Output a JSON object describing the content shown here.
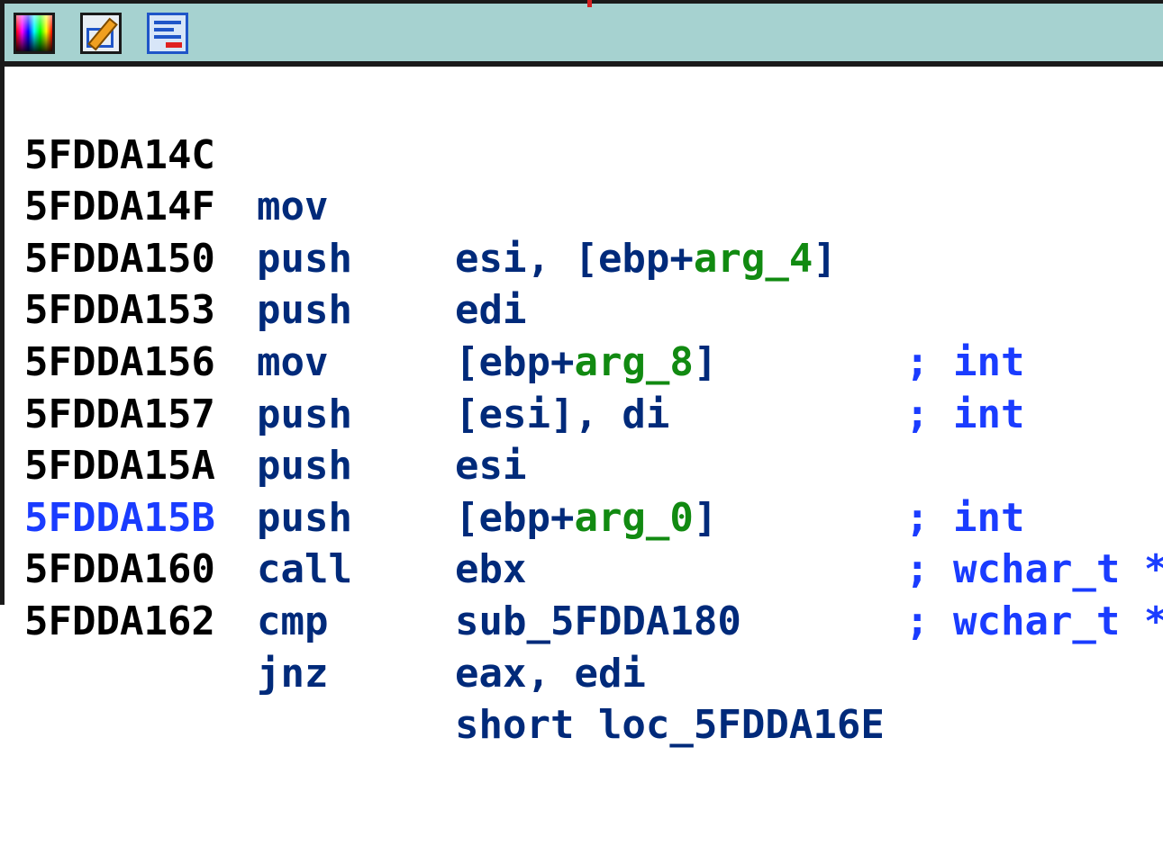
{
  "toolbar": {
    "icons": [
      "color-palette-icon",
      "edit-icon",
      "graph-view-icon"
    ]
  },
  "colors": {
    "titlebar": "#a6d2d0",
    "address": "#000000",
    "address_ref": "#1a3cff",
    "instruction": "#002a7a",
    "argument": "#118a11",
    "comment": "#1a3cff"
  },
  "disassembly": [
    {
      "address": "5FDDA14C",
      "mnemonic": "mov",
      "op_pre": "esi, [ebp+",
      "op_arg": "arg_4",
      "op_post": "]",
      "comment": ""
    },
    {
      "address": "5FDDA14F",
      "mnemonic": "push",
      "op_pre": "edi",
      "op_arg": "",
      "op_post": "",
      "comment": "; int"
    },
    {
      "address": "5FDDA150",
      "mnemonic": "push",
      "op_pre": "[ebp+",
      "op_arg": "arg_8",
      "op_post": "]",
      "comment": "; int"
    },
    {
      "address": "5FDDA153",
      "mnemonic": "mov",
      "op_pre": "[esi], di",
      "op_arg": "",
      "op_post": "",
      "comment": ""
    },
    {
      "address": "5FDDA156",
      "mnemonic": "push",
      "op_pre": "esi",
      "op_arg": "",
      "op_post": "",
      "comment": "; int"
    },
    {
      "address": "5FDDA157",
      "mnemonic": "push",
      "op_pre": "[ebp+",
      "op_arg": "arg_0",
      "op_post": "]",
      "comment": "; wchar_t *"
    },
    {
      "address": "5FDDA15A",
      "mnemonic": "push",
      "op_pre": "ebx",
      "op_arg": "",
      "op_post": "",
      "comment": "; wchar_t *"
    },
    {
      "address": "5FDDA15B",
      "mnemonic": "call",
      "op_pre": "sub_5FDDA180",
      "op_arg": "",
      "op_post": "",
      "comment": ""
    },
    {
      "address": "5FDDA160",
      "mnemonic": "cmp",
      "op_pre": "eax, edi",
      "op_arg": "",
      "op_post": "",
      "comment": ""
    },
    {
      "address": "5FDDA162",
      "mnemonic": "jnz",
      "op_pre": "short loc_5FDDA16E",
      "op_arg": "",
      "op_post": "",
      "comment": ""
    }
  ]
}
